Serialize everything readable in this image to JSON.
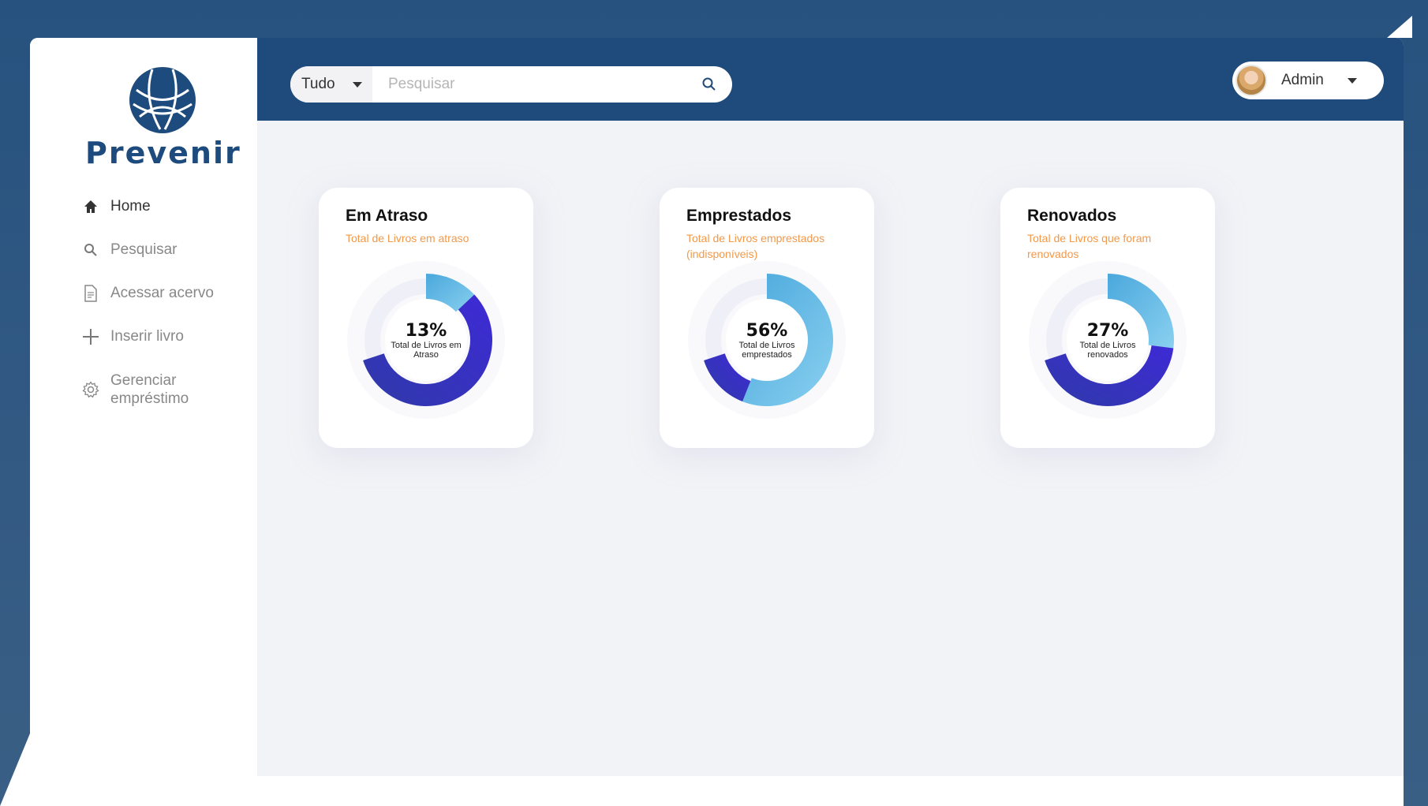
{
  "brand": {
    "name": "Prevenir",
    "color": "#1e4b7d"
  },
  "sidebar": {
    "items": [
      {
        "label": "Home",
        "icon": "home-icon",
        "active": true
      },
      {
        "label": "Pesquisar",
        "icon": "search-icon"
      },
      {
        "label": "Acessar acervo",
        "icon": "document-icon"
      },
      {
        "label": "Inserir livro",
        "icon": "plus-icon"
      },
      {
        "label": "Gerenciar empréstimo",
        "icon": "gear-icon"
      }
    ]
  },
  "search": {
    "filter_value": "Tudo",
    "placeholder": "Pesquisar",
    "value": ""
  },
  "user": {
    "name": "Admin"
  },
  "cards": [
    {
      "title": "Em Atraso",
      "subtitle": "Total de Livros  em atraso",
      "percent_label": "13%",
      "center_label": "Total de Livros em Atraso"
    },
    {
      "title": "Emprestados",
      "subtitle": "Total de Livros  emprestados (indisponíveis)",
      "percent_label": "56%",
      "center_label": "Total de Livros emprestados"
    },
    {
      "title": "Renovados",
      "subtitle": "Total de Livros que foram renovados",
      "percent_label": "27%",
      "center_label": "Total de Livros renovados"
    }
  ],
  "chart_data": [
    {
      "type": "pie",
      "title": "Em Atraso",
      "donut": true,
      "values": [
        13
      ],
      "series_colors": [
        "#56b4e3",
        "#3a2bd3"
      ]
    },
    {
      "type": "pie",
      "title": "Emprestados",
      "donut": true,
      "values": [
        56
      ],
      "series_colors": [
        "#56b4e3",
        "#3a2bd3"
      ]
    },
    {
      "type": "pie",
      "title": "Renovados",
      "donut": true,
      "values": [
        27
      ],
      "series_colors": [
        "#56b4e3",
        "#3a2bd3"
      ]
    }
  ],
  "colors": {
    "topbar": "#1f4a7c",
    "accent_orange": "#f2994a",
    "page_bg": "#f2f3f7"
  }
}
